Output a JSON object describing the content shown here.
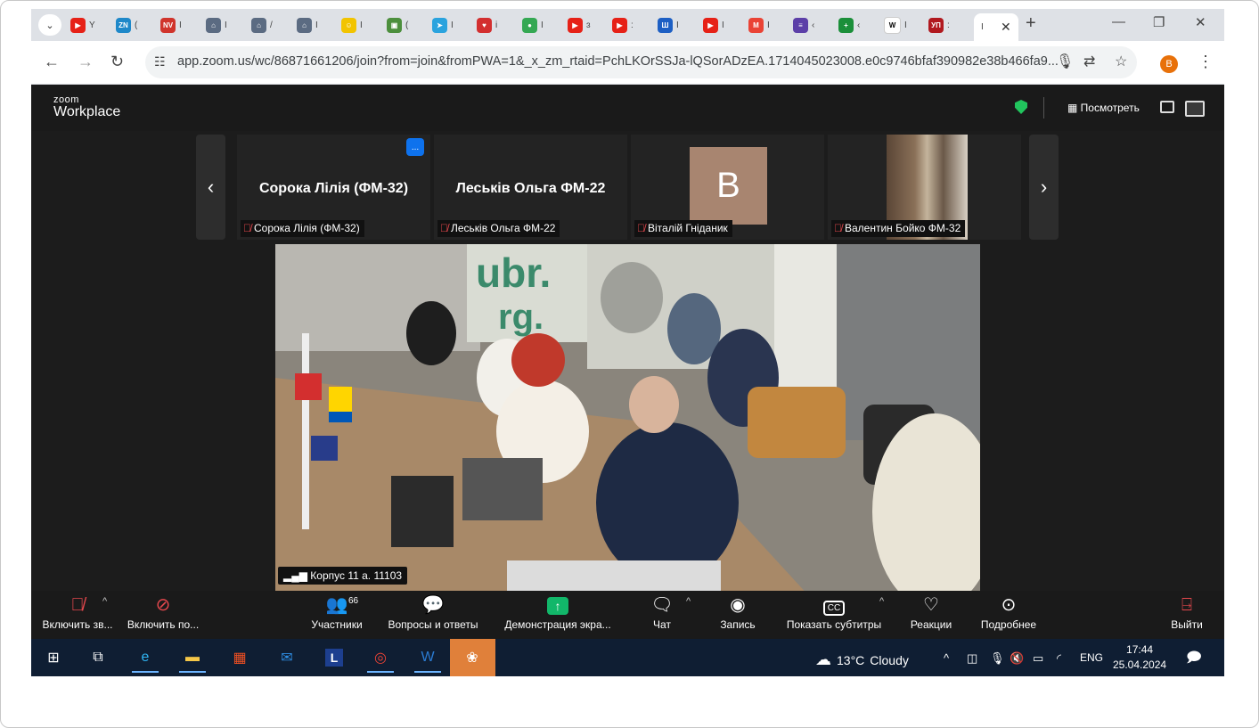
{
  "browser": {
    "tabs": [
      {
        "icon": "youtube-icon",
        "color": "#e62117",
        "glyph": "▶",
        "title": "Y"
      },
      {
        "icon": "zn-icon",
        "color": "#1e88c9",
        "glyph": "ZN",
        "title": "("
      },
      {
        "icon": "nv-icon",
        "color": "#d0342c",
        "glyph": "NV",
        "title": "I"
      },
      {
        "icon": "gov-icon",
        "color": "#5b6b82",
        "glyph": "⌂",
        "title": "I"
      },
      {
        "icon": "gov-icon",
        "color": "#5b6b82",
        "glyph": "⌂",
        "title": "/"
      },
      {
        "icon": "gov-icon",
        "color": "#5b6b82",
        "glyph": "⌂",
        "title": "I"
      },
      {
        "icon": "emoji-icon",
        "color": "#f2c400",
        "glyph": "☺",
        "title": "I"
      },
      {
        "icon": "briefcase-icon",
        "color": "#4c8f3d",
        "glyph": "▣",
        "title": "("
      },
      {
        "icon": "telegram-icon",
        "color": "#2aa3de",
        "glyph": "➤",
        "title": "I"
      },
      {
        "icon": "heart-icon",
        "color": "#d32f2f",
        "glyph": "♥",
        "title": "i"
      },
      {
        "icon": "maps-icon",
        "color": "#34a853",
        "glyph": "●",
        "title": "I"
      },
      {
        "icon": "youtube-icon",
        "color": "#e62117",
        "glyph": "▶",
        "title": "ɜ"
      },
      {
        "icon": "youtube-icon",
        "color": "#e62117",
        "glyph": "▶",
        "title": ":"
      },
      {
        "icon": "trident-icon",
        "color": "#1d5fc4",
        "glyph": "Ш",
        "title": "I"
      },
      {
        "icon": "youtube-icon",
        "color": "#e62117",
        "glyph": "▶",
        "title": "I"
      },
      {
        "icon": "gmail-icon",
        "color": "#ea4335",
        "glyph": "M",
        "title": "I"
      },
      {
        "icon": "list-icon",
        "color": "#5c3fa8",
        "glyph": "≡",
        "title": "‹"
      },
      {
        "icon": "plus-square-icon",
        "color": "#1b8f3a",
        "glyph": "+",
        "title": "‹"
      },
      {
        "icon": "wikipedia-icon",
        "color": "#ffffff",
        "glyph": "W",
        "title": "I"
      },
      {
        "icon": "up-icon",
        "color": "#b1191f",
        "glyph": "УП",
        "title": ":"
      }
    ],
    "active_tab_title": "I",
    "url": "app.zoom.us/wc/86871661206/join?from=join&fromPWA=1&_x_zm_rtaid=PchLKOrSSJa-lQSorADzEA.1714045023008.e0c9746bfaf390982e38b466fa9...",
    "profile_initial": "B"
  },
  "zoom": {
    "logo_small": "zoom",
    "logo_big": "Workplace",
    "view_label": "Посмотреть",
    "participants": [
      {
        "big_name": "Сорока Лілія (ФМ-32)",
        "label": "Сорока Лілія (ФМ-32)"
      },
      {
        "big_name": "Леськів Ольга ФМ-22",
        "label": "Леськів Ольга ФМ-22"
      },
      {
        "avatar_letter": "B",
        "avatar_color": "#a88570",
        "label": "Віталій Гніданик"
      },
      {
        "label": "Валентин Бойко ФМ-32"
      }
    ],
    "more_button": "...",
    "main_video_name": "Корпус 11 а. 11103",
    "controls": {
      "audio": "Включить зв...",
      "video": "Включить по...",
      "participants": "Участники",
      "participants_count": "66",
      "qa": "Вопросы и ответы",
      "share": "Демонстрация экра...",
      "chat": "Чат",
      "record": "Запись",
      "captions": "Показать субтитры",
      "captions_icon": "CC",
      "reactions": "Реакции",
      "more": "Подробнее",
      "leave": "Выйти"
    }
  },
  "taskbar": {
    "weather_temp": "13°C",
    "weather_text": "Cloudy",
    "lang": "ENG",
    "time": "17:44",
    "date": "25.04.2024",
    "launcher_letter": "L"
  }
}
